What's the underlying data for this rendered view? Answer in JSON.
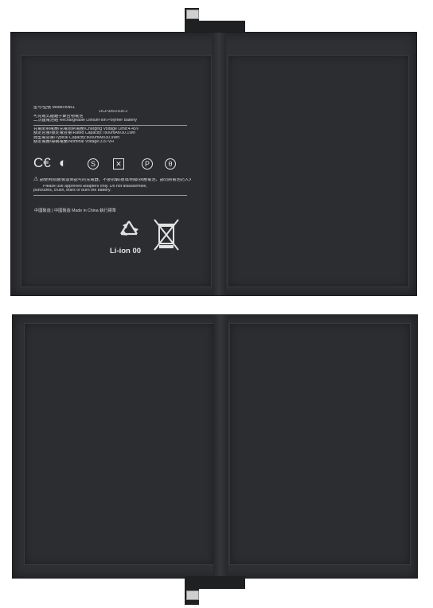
{
  "label": {
    "line1": "型号/型號 Model:BN61",
    "line2": "1ICP3/81/100-2",
    "line3": "可充電式鋰離子聚合物電池",
    "line4": "二次鋰電池組 Rechargeable Lithium-ion Polymer Battery",
    "line5": "充電限制電壓/充電限制電壓/Charging Voltage Limit:4.45V",
    "line6": "額定容量/額定電容量/Rated Capacity:7800mAh/30.1Wh",
    "line7": "典型電容量/Typical Capacity:8000mAh/30.9Wh",
    "line8": "額定電壓/標稱電壓/Nominal Voltage:3.87VH",
    "warning1": "請使用原廠/製造商認可的充電器，不要拆解/損壞/刺破/擠壓電池，請勿將電池扔入火中。",
    "warning2": "Please use approved adapters only. Do not disassemble,",
    "warning3": "punctures, crush, tears or burn the battery.",
    "made_in": "中國製造 | 中國製造   Made in China    執行標準",
    "recycle_text": "Li-ion 00"
  },
  "icons": [
    "ce-mark-icon",
    "c-mark-icon",
    "s-mark-icon",
    "x-box-icon",
    "pse-icon",
    "theta-icon"
  ],
  "colors": {
    "battery": "#2e3033",
    "label_text": "#d9d9d9",
    "connector": "#cfcfcf"
  }
}
